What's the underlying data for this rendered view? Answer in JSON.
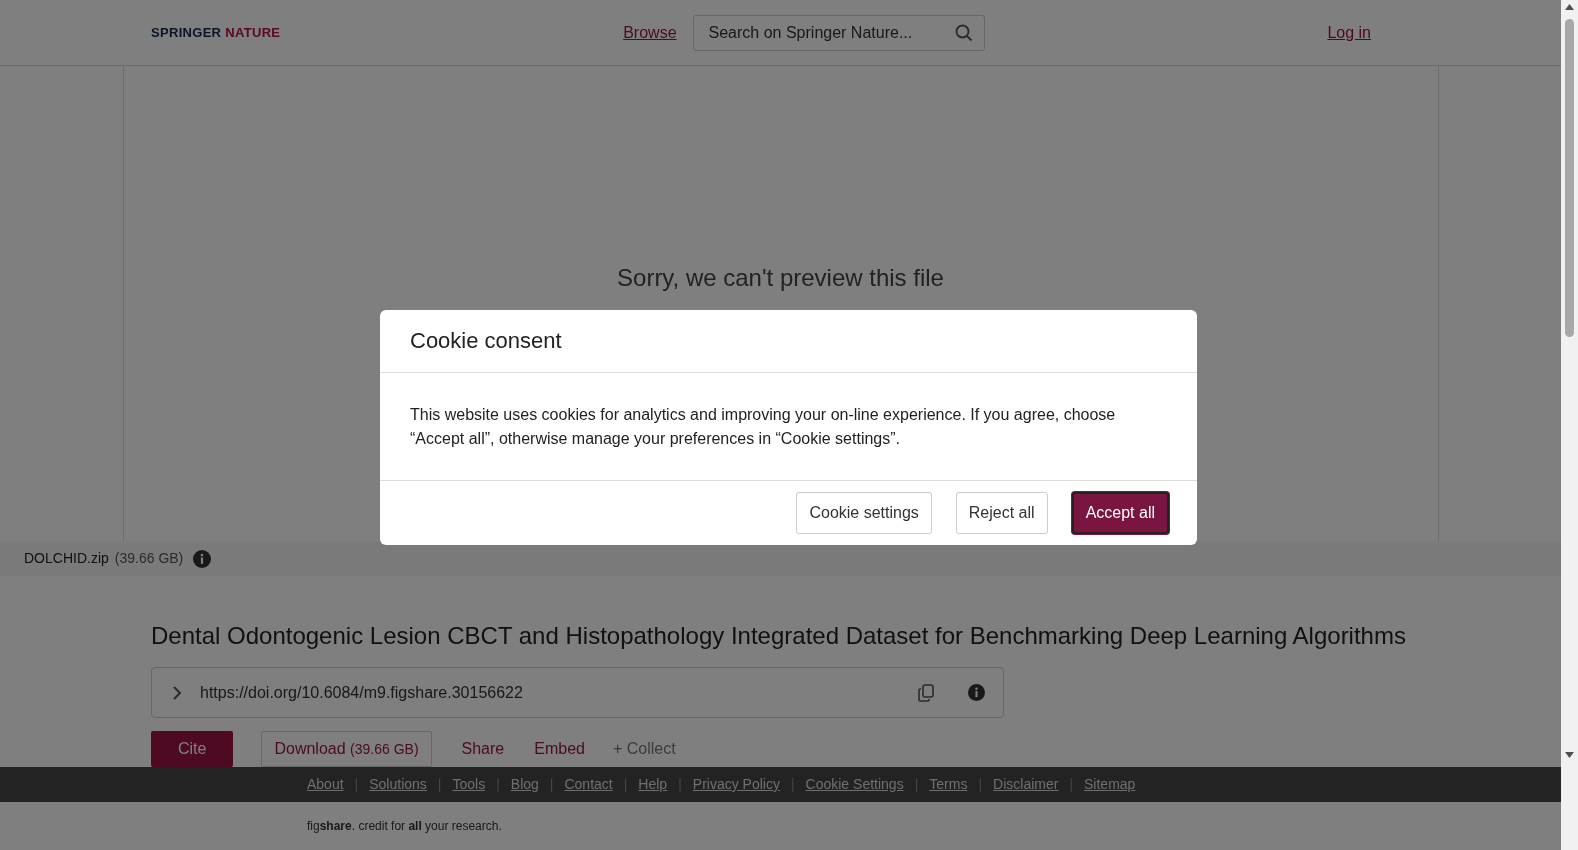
{
  "header": {
    "logo": {
      "first": "SPRINGER",
      "second": "NATURE"
    },
    "browse": "Browse",
    "search": {
      "placeholder": "Search on Springer Nature..."
    },
    "login": "Log in"
  },
  "preview": {
    "message": "Sorry, we can't preview this file"
  },
  "file_bar": {
    "name": "DOLCHID.zip",
    "size": "(39.66 GB)"
  },
  "item": {
    "title": "Dental Odontogenic Lesion CBCT and Histopathology Integrated Dataset for Benchmarking Deep Learning Algorithms",
    "doi": "https://doi.org/10.6084/m9.figshare.30156622",
    "actions": [
      {
        "kind": "primary",
        "label": "Cite"
      },
      {
        "kind": "outline",
        "label": "Download",
        "note": "(39.66 GB)"
      },
      {
        "kind": "link",
        "label": "Share"
      },
      {
        "kind": "link",
        "label": "Embed"
      },
      {
        "kind": "muted",
        "label": "+ Collect"
      }
    ]
  },
  "footer": {
    "separator": "|",
    "links": [
      "About",
      "Solutions",
      "Tools",
      "Blog",
      "Contact",
      "Help",
      "Privacy Policy",
      "Cookie Settings",
      "Terms",
      "Disclaimer",
      "Sitemap"
    ],
    "tagline": "fig**share**. credit for **all** your research."
  },
  "modal": {
    "title": "Cookie consent",
    "body": "This website uses cookies for analytics and improving your on-line experience. If you agree, choose “Accept all”, otherwise manage your preferences in “Cookie settings”.",
    "buttons": [
      {
        "label": "Cookie settings",
        "primary": false
      },
      {
        "label": "Reject all",
        "primary": false
      },
      {
        "label": "Accept all",
        "primary": true
      }
    ]
  }
}
